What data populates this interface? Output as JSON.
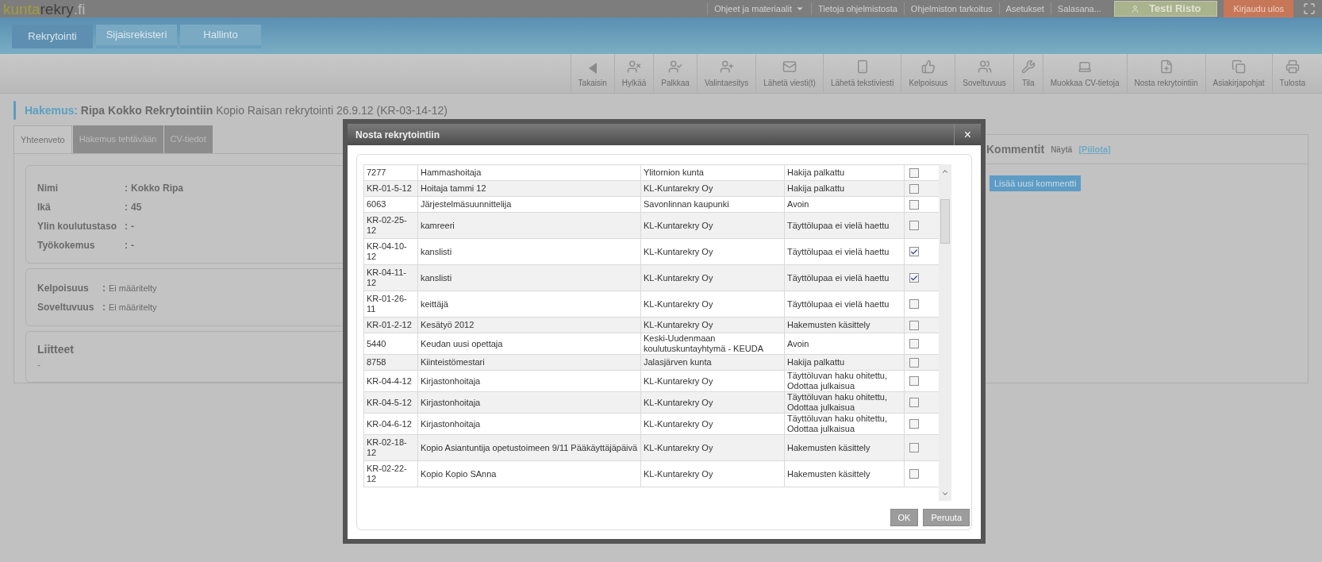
{
  "logo": {
    "first": "kunta",
    "second": "rekry",
    "third": ".fi"
  },
  "top_links": [
    {
      "label": "Ohjeet ja materiaalit",
      "kind": "menu"
    },
    {
      "label": "Tietoja ohjelmistosta",
      "kind": "link"
    },
    {
      "label": "Ohjelmiston tarkoitus",
      "kind": "link"
    },
    {
      "label": "Asetukset",
      "kind": "link"
    },
    {
      "label": "Salasana...",
      "kind": "link"
    }
  ],
  "user_button": "Testi Risto",
  "logout_button": "Kirjaudu ulos",
  "nav_tabs": [
    {
      "label": "Rekrytointi",
      "selected": true
    },
    {
      "label": "Sijaisrekisteri",
      "selected": false
    },
    {
      "label": "Hallinto",
      "selected": false
    }
  ],
  "toolbar": [
    "Takaisin",
    "Hylkää",
    "Palkkaa",
    "Valintaesitys",
    "Lähetä viesti(t)",
    "Lähetä tekstiviesti",
    "Kelpoisuus",
    "Soveltuvuus",
    "Tila",
    "Muokkaa CV-tietoja",
    "Nosta rekrytointiin",
    "Asiakirjapohjat",
    "Tulosta"
  ],
  "heading": {
    "prefix": "Hakemus:",
    "name": "Ripa Kokko Rekrytointiin",
    "detail": "Kopio Raisan rekrytointi 26.9.12 (KR-03-14-12)"
  },
  "tabs": [
    {
      "label": "Yhteenveto",
      "selected": true
    },
    {
      "label": "Hakemus tehtävään",
      "selected": false
    },
    {
      "label": "CV-tiedot",
      "selected": false
    }
  ],
  "summary": {
    "separator": ":",
    "fields": [
      {
        "label": "Nimi",
        "value": "Kokko Ripa"
      },
      {
        "label": "Ikä",
        "value": "45"
      },
      {
        "label": "Ylin koulutustaso",
        "value": "-"
      },
      {
        "label": "Työkokemus",
        "value": "-"
      }
    ]
  },
  "suitability": {
    "separator": ":",
    "fields": [
      {
        "label": "Kelpoisuus",
        "value": "Ei määritelty"
      },
      {
        "label": "Soveltuvuus",
        "value": "Ei määritelty"
      }
    ]
  },
  "attachments": {
    "title": "Liitteet",
    "value": "-"
  },
  "comments": {
    "title": "Kommentit",
    "show": "Näytä",
    "hide": "[Piilota]",
    "add_button": "Lisää uusi kommentti"
  },
  "dialog": {
    "title": "Nosta rekrytointiin",
    "close": "×",
    "rows": [
      {
        "code": "7277",
        "title": "Hammashoitaja",
        "organization": "Ylitornion kunta",
        "status": "Hakija palkattu",
        "checked": false
      },
      {
        "code": "KR-01-5-12",
        "title": "Hoitaja tammi 12",
        "organization": "KL-Kuntarekry Oy",
        "status": "Hakija palkattu",
        "checked": false
      },
      {
        "code": "6063",
        "title": "Järjestelmäsuunnittelija",
        "organization": "Savonlinnan kaupunki",
        "status": "Avoin",
        "checked": false
      },
      {
        "code": "KR-02-25-12",
        "title": "kamreeri",
        "organization": "KL-Kuntarekry Oy",
        "status": "Täyttölupaa ei vielä haettu",
        "checked": false
      },
      {
        "code": "KR-04-10-12",
        "title": "kanslisti",
        "organization": "KL-Kuntarekry Oy",
        "status": "Täyttölupaa ei vielä haettu",
        "checked": true
      },
      {
        "code": "KR-04-11-12",
        "title": "kanslisti",
        "organization": "KL-Kuntarekry Oy",
        "status": "Täyttölupaa ei vielä haettu",
        "checked": true
      },
      {
        "code": "KR-01-26-11",
        "title": "keittäjä",
        "organization": "KL-Kuntarekry Oy",
        "status": "Täyttölupaa ei vielä haettu",
        "checked": false
      },
      {
        "code": "KR-01-2-12",
        "title": "Kesätyö 2012",
        "organization": "KL-Kuntarekry Oy",
        "status": "Hakemusten käsittely",
        "checked": false
      },
      {
        "code": "5440",
        "title": "Keudan uusi opettaja",
        "organization": "Keski-Uudenmaan koulutuskuntayhtymä - KEUDA",
        "status": "Avoin",
        "checked": false
      },
      {
        "code": "8758",
        "title": "Kiinteistömestari",
        "organization": "Jalasjärven kunta",
        "status": "Hakija palkattu",
        "checked": false
      },
      {
        "code": "KR-04-4-12",
        "title": "Kirjastonhoitaja",
        "organization": "KL-Kuntarekry Oy",
        "status": "Täyttöluvan haku ohitettu, Odottaa julkaisua",
        "checked": false
      },
      {
        "code": "KR-04-5-12",
        "title": "Kirjastonhoitaja",
        "organization": "KL-Kuntarekry Oy",
        "status": "Täyttöluvan haku ohitettu, Odottaa julkaisua",
        "checked": false
      },
      {
        "code": "KR-04-6-12",
        "title": "Kirjastonhoitaja",
        "organization": "KL-Kuntarekry Oy",
        "status": "Täyttöluvan haku ohitettu, Odottaa julkaisua",
        "checked": false
      },
      {
        "code": "KR-02-18-12",
        "title": "Kopio Asiantuntija opetustoimeen 9/11 Pääkäyttäjäpäivä",
        "organization": "KL-Kuntarekry Oy",
        "status": "Hakemusten käsittely",
        "checked": false
      },
      {
        "code": "KR-02-22-12",
        "title": "Kopio Kopio SAnna",
        "organization": "KL-Kuntarekry Oy",
        "status": "Hakemusten käsittely",
        "checked": false
      }
    ],
    "buttons": [
      {
        "label": "OK"
      },
      {
        "label": "Peruuta"
      }
    ]
  }
}
